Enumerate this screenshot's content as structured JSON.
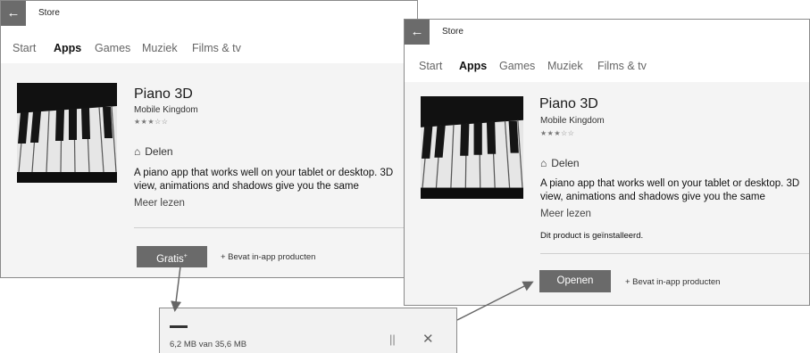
{
  "window1": {
    "title": "Store",
    "nav": [
      "Start",
      "Apps",
      "Games",
      "Muziek",
      "Films & tv"
    ],
    "app": {
      "name": "Piano 3D",
      "publisher": "Mobile Kingdom",
      "rating_stars": "★★★☆☆",
      "share_label": "Delen",
      "description": "A piano app that works well on your tablet or desktop. 3D view, animations and shadows give you the same",
      "read_more": "Meer lezen",
      "get_button": "Gratis",
      "get_button_sup": "+",
      "in_app": "+ Bevat in-app producten"
    }
  },
  "download": {
    "size_text": "6,2 MB van 35,6 MB",
    "progress": 0.17,
    "pause_icon": "pause-icon",
    "close_icon": "close-icon"
  },
  "window2": {
    "title": "Store",
    "nav": [
      "Start",
      "Apps",
      "Games",
      "Muziek",
      "Films & tv"
    ],
    "app": {
      "name": "Piano 3D",
      "publisher": "Mobile Kingdom",
      "rating_stars": "★★★☆☆",
      "share_label": "Delen",
      "description": "A piano app that works well on your tablet or desktop. 3D view, animations and shadows give you the same",
      "read_more": "Meer lezen",
      "installed_note": "Dit product is geïnstalleerd.",
      "open_button": "Openen",
      "in_app": "+ Bevat in-app producten"
    }
  },
  "icons": {
    "back": "back-arrow-icon",
    "share": "share-icon",
    "stars": "rating-stars-icon"
  }
}
